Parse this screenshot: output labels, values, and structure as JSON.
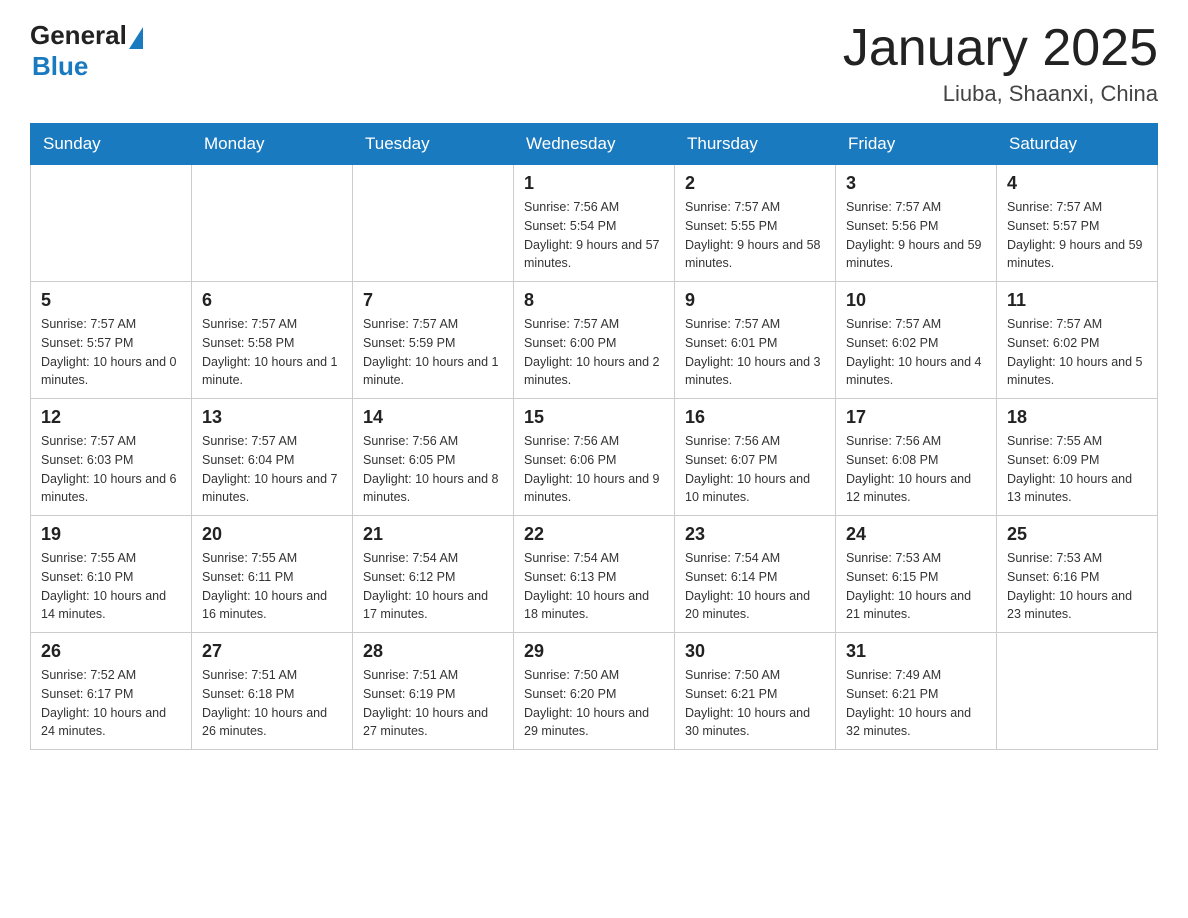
{
  "header": {
    "logo_general": "General",
    "logo_blue": "Blue",
    "title": "January 2025",
    "subtitle": "Liuba, Shaanxi, China"
  },
  "days_of_week": [
    "Sunday",
    "Monday",
    "Tuesday",
    "Wednesday",
    "Thursday",
    "Friday",
    "Saturday"
  ],
  "weeks": [
    [
      {
        "day": "",
        "info": ""
      },
      {
        "day": "",
        "info": ""
      },
      {
        "day": "",
        "info": ""
      },
      {
        "day": "1",
        "info": "Sunrise: 7:56 AM\nSunset: 5:54 PM\nDaylight: 9 hours and 57 minutes."
      },
      {
        "day": "2",
        "info": "Sunrise: 7:57 AM\nSunset: 5:55 PM\nDaylight: 9 hours and 58 minutes."
      },
      {
        "day": "3",
        "info": "Sunrise: 7:57 AM\nSunset: 5:56 PM\nDaylight: 9 hours and 59 minutes."
      },
      {
        "day": "4",
        "info": "Sunrise: 7:57 AM\nSunset: 5:57 PM\nDaylight: 9 hours and 59 minutes."
      }
    ],
    [
      {
        "day": "5",
        "info": "Sunrise: 7:57 AM\nSunset: 5:57 PM\nDaylight: 10 hours and 0 minutes."
      },
      {
        "day": "6",
        "info": "Sunrise: 7:57 AM\nSunset: 5:58 PM\nDaylight: 10 hours and 1 minute."
      },
      {
        "day": "7",
        "info": "Sunrise: 7:57 AM\nSunset: 5:59 PM\nDaylight: 10 hours and 1 minute."
      },
      {
        "day": "8",
        "info": "Sunrise: 7:57 AM\nSunset: 6:00 PM\nDaylight: 10 hours and 2 minutes."
      },
      {
        "day": "9",
        "info": "Sunrise: 7:57 AM\nSunset: 6:01 PM\nDaylight: 10 hours and 3 minutes."
      },
      {
        "day": "10",
        "info": "Sunrise: 7:57 AM\nSunset: 6:02 PM\nDaylight: 10 hours and 4 minutes."
      },
      {
        "day": "11",
        "info": "Sunrise: 7:57 AM\nSunset: 6:02 PM\nDaylight: 10 hours and 5 minutes."
      }
    ],
    [
      {
        "day": "12",
        "info": "Sunrise: 7:57 AM\nSunset: 6:03 PM\nDaylight: 10 hours and 6 minutes."
      },
      {
        "day": "13",
        "info": "Sunrise: 7:57 AM\nSunset: 6:04 PM\nDaylight: 10 hours and 7 minutes."
      },
      {
        "day": "14",
        "info": "Sunrise: 7:56 AM\nSunset: 6:05 PM\nDaylight: 10 hours and 8 minutes."
      },
      {
        "day": "15",
        "info": "Sunrise: 7:56 AM\nSunset: 6:06 PM\nDaylight: 10 hours and 9 minutes."
      },
      {
        "day": "16",
        "info": "Sunrise: 7:56 AM\nSunset: 6:07 PM\nDaylight: 10 hours and 10 minutes."
      },
      {
        "day": "17",
        "info": "Sunrise: 7:56 AM\nSunset: 6:08 PM\nDaylight: 10 hours and 12 minutes."
      },
      {
        "day": "18",
        "info": "Sunrise: 7:55 AM\nSunset: 6:09 PM\nDaylight: 10 hours and 13 minutes."
      }
    ],
    [
      {
        "day": "19",
        "info": "Sunrise: 7:55 AM\nSunset: 6:10 PM\nDaylight: 10 hours and 14 minutes."
      },
      {
        "day": "20",
        "info": "Sunrise: 7:55 AM\nSunset: 6:11 PM\nDaylight: 10 hours and 16 minutes."
      },
      {
        "day": "21",
        "info": "Sunrise: 7:54 AM\nSunset: 6:12 PM\nDaylight: 10 hours and 17 minutes."
      },
      {
        "day": "22",
        "info": "Sunrise: 7:54 AM\nSunset: 6:13 PM\nDaylight: 10 hours and 18 minutes."
      },
      {
        "day": "23",
        "info": "Sunrise: 7:54 AM\nSunset: 6:14 PM\nDaylight: 10 hours and 20 minutes."
      },
      {
        "day": "24",
        "info": "Sunrise: 7:53 AM\nSunset: 6:15 PM\nDaylight: 10 hours and 21 minutes."
      },
      {
        "day": "25",
        "info": "Sunrise: 7:53 AM\nSunset: 6:16 PM\nDaylight: 10 hours and 23 minutes."
      }
    ],
    [
      {
        "day": "26",
        "info": "Sunrise: 7:52 AM\nSunset: 6:17 PM\nDaylight: 10 hours and 24 minutes."
      },
      {
        "day": "27",
        "info": "Sunrise: 7:51 AM\nSunset: 6:18 PM\nDaylight: 10 hours and 26 minutes."
      },
      {
        "day": "28",
        "info": "Sunrise: 7:51 AM\nSunset: 6:19 PM\nDaylight: 10 hours and 27 minutes."
      },
      {
        "day": "29",
        "info": "Sunrise: 7:50 AM\nSunset: 6:20 PM\nDaylight: 10 hours and 29 minutes."
      },
      {
        "day": "30",
        "info": "Sunrise: 7:50 AM\nSunset: 6:21 PM\nDaylight: 10 hours and 30 minutes."
      },
      {
        "day": "31",
        "info": "Sunrise: 7:49 AM\nSunset: 6:21 PM\nDaylight: 10 hours and 32 minutes."
      },
      {
        "day": "",
        "info": ""
      }
    ]
  ]
}
